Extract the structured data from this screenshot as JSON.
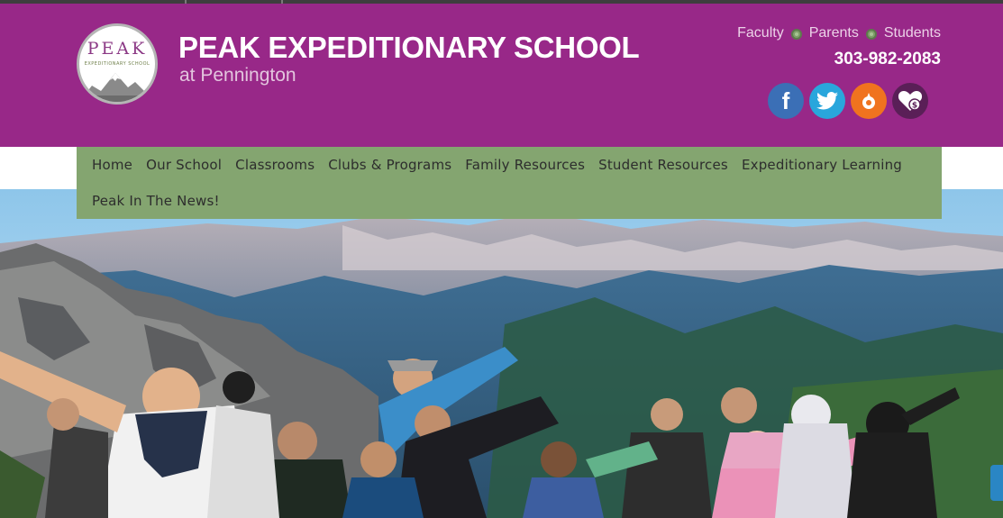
{
  "header": {
    "school_name": "PEAK EXPEDITIONARY SCHOOL",
    "school_sub": "at Pennington",
    "logo_text": "PEAK",
    "logo_sub": "EXPEDITIONARY SCHOOL",
    "audience_links": [
      "Faculty",
      "Parents",
      "Students"
    ],
    "phone": "303-982-2083",
    "social": [
      "facebook-icon",
      "twitter-icon",
      "kickstarter-icon",
      "donate-heart-icon"
    ]
  },
  "nav": {
    "items": [
      "Home",
      "Our School",
      "Classrooms",
      "Clubs & Programs",
      "Family Resources",
      "Student Resources",
      "Expeditionary Learning",
      "Peak In The News!"
    ]
  },
  "hero": {
    "image": "mountain-summit-students-photo"
  },
  "colors": {
    "header_purple": "#982888",
    "nav_green": "#84a570",
    "phone": "#ffffff"
  }
}
